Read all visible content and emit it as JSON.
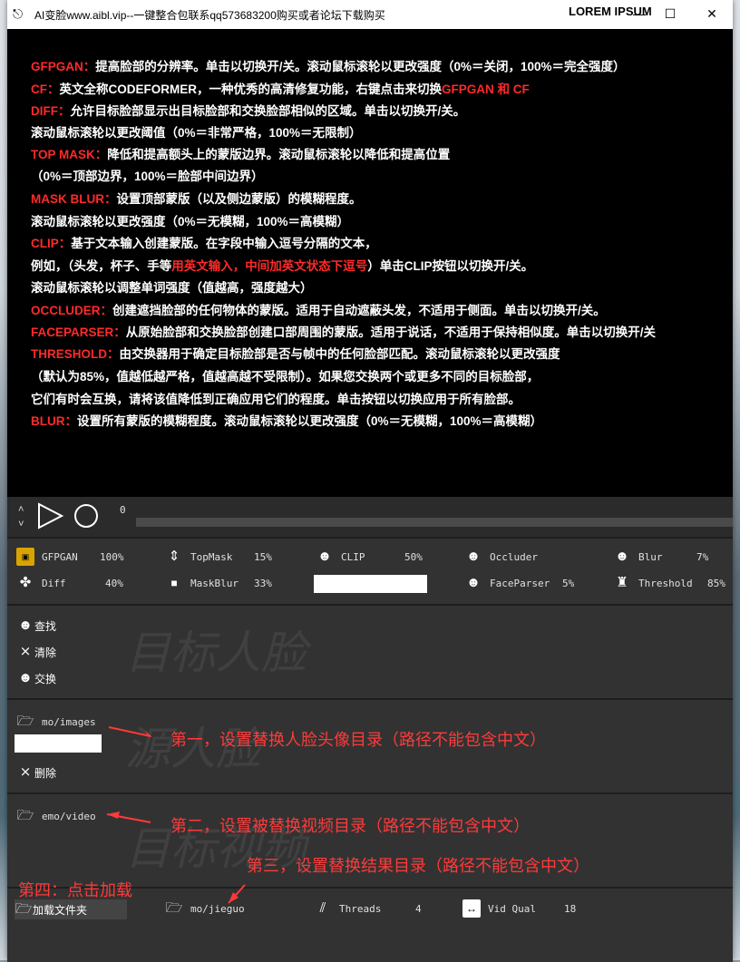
{
  "window": {
    "title": "AI变脸www.aibl.vip--一键整合包联系qq573683200购买或者论坛下载购买",
    "brand": "LOREM IPSUM",
    "minimize": "—",
    "maximize": "☐",
    "close": "✕"
  },
  "help": {
    "l1k": "GFPGAN：",
    "l1t": "提高脸部的分辨率。单击以切换开/关。滚动鼠标滚轮以更改强度（0%＝关闭，100%＝完全强度）",
    "l2k": "CF：",
    "l2t": "英文全称CODEFORMER，一种优秀的高清修复功能，右键点击来切换",
    "l2k2": "GFPGAN 和 CF",
    "l3k": "DIFF：",
    "l3t": "允许目标脸部显示出目标脸部和交换脸部相似的区域。单击以切换开/关。",
    "l4t": "滚动鼠标滚轮以更改阈值（0%＝非常严格，100%＝无限制）",
    "l5k": "TOP MASK：",
    "l5t": "降低和提高额头上的蒙版边界。滚动鼠标滚轮以降低和提高位置",
    "l6t": "（0%＝顶部边界，100%＝脸部中间边界）",
    "l7k": "MASK BLUR：",
    "l7t": "设置顶部蒙版（以及侧边蒙版）的模糊程度。",
    "l8t": "滚动鼠标滚轮以更改强度（0%＝无模糊，100%＝高模糊）",
    "l9k": "CLIP：",
    "l9t": "基于文本输入创建蒙版。在字段中输入逗号分隔的文本，",
    "l10t": "例如，（头发，杯子、手等",
    "l10k": "用英文输入，中间加英文状态下逗号",
    "l10t2": "）单击CLIP按钮以切换开/关。",
    "l11t": "滚动鼠标滚轮以调整单词强度（值越高，强度越大）",
    "l12k": "OCCLUDER：",
    "l12t": "创建遮挡脸部的任何物体的蒙版。适用于自动遮蔽头发，不适用于侧面。单击以切换开/关。",
    "l13k": "FACEPARSER：",
    "l13t": "从原始脸部和交换脸部创建口部周围的蒙版。适用于说话，不适用于保持相似度。单击以切换开/关",
    "l14k": "THRESHOLD：",
    "l14t": "由交换器用于确定目标脸部是否与帧中的任何脸部匹配。滚动鼠标滚轮以更改强度",
    "l15t": "（默认为85%，值越低越严格，值越高越不受限制）。如果您交换两个或更多不同的目标脸部，",
    "l16t": "它们有时会互换，请将该值降低到正确应用它们的程度。单击按钮以切换应用于所有脸部。",
    "l17k": "BLUR：",
    "l17t": "设置所有蒙版的模糊程度。滚动鼠标滚轮以更改强度（0%＝无模糊，100%＝高模糊）"
  },
  "transport": {
    "up": "˄",
    "down": "˄",
    "frame": "0"
  },
  "params": {
    "gfpgan": {
      "label": "GFPGAN",
      "value": "100%"
    },
    "topmask": {
      "label": "TopMask",
      "value": "15%"
    },
    "clip": {
      "label": "CLIP",
      "value": "50%"
    },
    "occluder": {
      "label": "Occluder"
    },
    "blur": {
      "label": "Blur",
      "value": "7%"
    },
    "diff": {
      "label": "Diff",
      "value": "40%"
    },
    "maskblur": {
      "label": "MaskBlur",
      "value": "33%"
    },
    "faceparser": {
      "label": "FaceParser",
      "value": "5%"
    },
    "threshold": {
      "label": "Threshold",
      "value": "85%"
    }
  },
  "target": {
    "watermark": "目标人脸",
    "find": "查找",
    "clear": "清除",
    "swap": "交换"
  },
  "source": {
    "watermark": "源人脸",
    "folder": "mo/images",
    "delete": "删除"
  },
  "video": {
    "watermark": "目标视频",
    "folder": "emo/video"
  },
  "footer": {
    "load": "加载文件夹",
    "output": "mo/jieguo",
    "threads_label": "Threads",
    "threads_value": "4",
    "vidqual_label": "Vid Qual",
    "vidqual_value": "18"
  },
  "annotations": {
    "a1": "第一，设置替换人脸头像目录（路径不能包含中文）",
    "a2": "第二，设置被替换视频目录（路径不能包含中文）",
    "a3": "第三，设置替换结果目录（路径不能包含中文）",
    "a4": "第四：点击加载"
  },
  "colors": {
    "accent": "#ff2a2a",
    "annotation": "#ff3a3a"
  }
}
